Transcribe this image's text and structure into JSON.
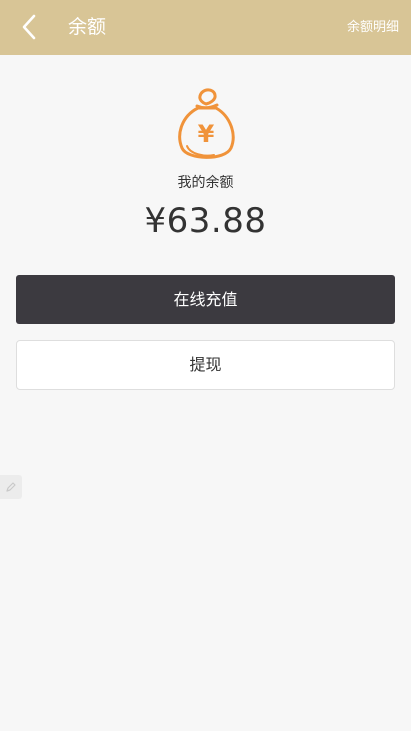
{
  "header": {
    "back_icon": "chevron-left-icon",
    "title": "余额",
    "detail_link": "余额明细"
  },
  "wallet": {
    "icon": "money-bag-yuan-icon",
    "icon_symbol": "¥",
    "label": "我的余额",
    "amount": "¥63.88"
  },
  "actions": {
    "recharge_label": "在线充值",
    "withdraw_label": "提现"
  },
  "side_tab": {
    "icon": "edit-icon"
  },
  "colors": {
    "header_bg": "#d8c596",
    "accent_orange": "#f0933a",
    "primary_button": "#3c3a40",
    "page_bg": "#f7f7f7"
  }
}
